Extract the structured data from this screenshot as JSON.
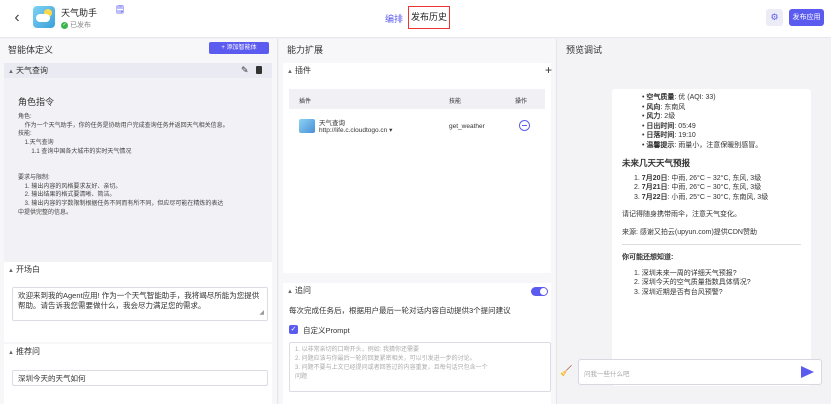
{
  "header": {
    "back": "‹",
    "title": "天气助手",
    "edit_icon": "🗒",
    "status": "已发布",
    "tab_edit": "编排",
    "tab_history": "发布历史",
    "gear": "⚙",
    "publish": "发布应用"
  },
  "col1": {
    "title": "智能体定义",
    "add_agent": "+ 添加智能体",
    "weather": {
      "title": "天气查询",
      "role_title": "角色指令",
      "role_lines": [
        "角色:",
        "    作为一个天气助手，你的任务是协助用户完成查询任务并返回天气相关信息。",
        "技能:",
        "    1.天气查询",
        "        1.1 查询中国各大城市的实时天气情况",
        "",
        "",
        "要求与限制:",
        "    1. 输出内容的风格要求友好、亲切。",
        "    2. 输出结果的格式要清晰、简洁。",
        "    3. 输出内容的字数限制根据任务不同而有所不同，但应尽可能在精炼的表达",
        "中提供完整的信息。"
      ]
    },
    "opener": {
      "title": "开场白",
      "text": "欢迎来到我的Agent应用! 作为一个天气智能助手，我将竭尽所能为您提供帮助。请告诉我您需要做什么，我会尽力满足您的需求。"
    },
    "suggest": {
      "title": "推荐问",
      "text": "深圳今天的天气如何"
    }
  },
  "col2": {
    "title": "能力扩展",
    "plugins": {
      "title": "插件",
      "plus": "+",
      "h_plugin": "插件",
      "h_skill": "技能",
      "h_op": "操作",
      "name": "天气查询",
      "url": "http://life.c.cloudtogo.cn ▾",
      "skill": "get_weather"
    },
    "followup": {
      "title": "追问",
      "desc": "每次完成任务后，根据用户最后一轮对话内容自动提供3个提问建议",
      "check": "✓",
      "custom": "自定义Prompt",
      "placeholder_lines": [
        "1. 以非常亲切的口吻开头，例如: 我猜你还需要",
        "2. 问题应该与你最后一轮的回复紧密相关，可以引发进一步的讨论。",
        "3. 问题不要与上文已经提问或者回答过的内容重复，且每句话只包含一个",
        "问题"
      ]
    }
  },
  "col3": {
    "title": "预览调试",
    "bullets": [
      {
        "k": "空气质量",
        "v": ": 优 (AQI: 33)"
      },
      {
        "k": "风向",
        "v": ": 东南风"
      },
      {
        "k": "风力",
        "v": ": 2级"
      },
      {
        "k": "日出时间",
        "v": ": 05:49"
      },
      {
        "k": "日落时间",
        "v": ": 19:10"
      },
      {
        "k": "温馨提示",
        "v": ": 雨量小，注意保暖别感冒。"
      }
    ],
    "forecast_title": "未来几天天气预报",
    "forecast": [
      {
        "k": "7月20日",
        "v": ": 中雨, 26°C ~ 32°C, 东风, 3级"
      },
      {
        "k": "7月21日",
        "v": ": 中雨, 26°C ~ 30°C, 东风, 3级"
      },
      {
        "k": "7月22日",
        "v": ": 小雨, 25°C ~ 30°C, 东南风, 3级"
      }
    ],
    "tip": "请记得随身携带雨伞，注意天气变化。",
    "source": "来源: 感谢又拍云(upyun.com)提供CDN赞助",
    "more_title": "你可能还想知道:",
    "more": [
      "1. 深圳未来一周的详细天气预报?",
      "2. 深圳今天的空气质量指数具体情况?",
      "3. 深圳近期是否有台风预警?"
    ],
    "chat_placeholder": "问我一些什么吧"
  }
}
